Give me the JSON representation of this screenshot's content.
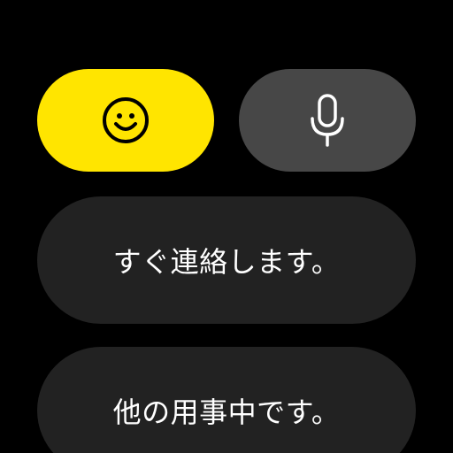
{
  "colors": {
    "background": "#000000",
    "emoji_button": "#ffe500",
    "voice_button": "#474747",
    "reply_button": "#222222",
    "text": "#ffffff"
  },
  "toolbar": {
    "emoji_icon": "smiley-face-icon",
    "voice_icon": "microphone-icon"
  },
  "quick_replies": [
    {
      "label": "すぐ連絡します。"
    },
    {
      "label": "他の用事中です。"
    }
  ]
}
